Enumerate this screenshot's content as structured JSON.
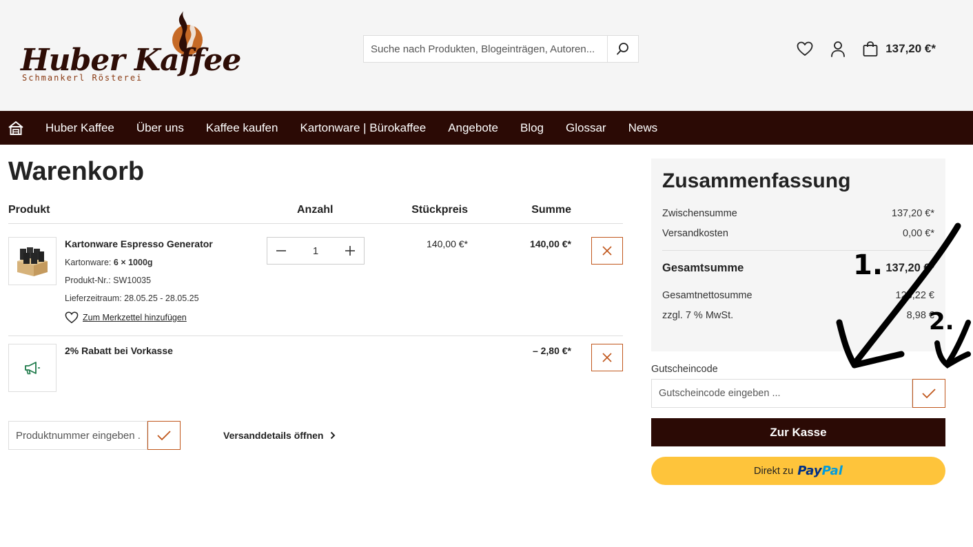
{
  "header": {
    "logo_title": "Huber Kaffee",
    "logo_subtitle": "Schmankerl Rösterei",
    "search_placeholder": "Suche nach Produkten, Blogeinträgen, Autoren...",
    "cart_total": "137,20 €*"
  },
  "nav": {
    "items": [
      "Huber Kaffee",
      "Über uns",
      "Kaffee kaufen",
      "Kartonware | Bürokaffee",
      "Angebote",
      "Blog",
      "Glossar",
      "News"
    ]
  },
  "cart": {
    "title": "Warenkorb",
    "columns": {
      "product": "Produkt",
      "quantity": "Anzahl",
      "unit_price": "Stückpreis",
      "total": "Summe"
    },
    "items": [
      {
        "name": "Kartonware Espresso Generator",
        "variant_label": "Kartonware:",
        "variant_value": "6 × 1000g",
        "sku": "Produkt-Nr.: SW10035",
        "delivery": "Lieferzeitraum: 28.05.25 - 28.05.25",
        "wishlist_link": "Zum Merkzettel hinzufügen",
        "quantity": "1",
        "unit_price": "140,00 €*",
        "total": "140,00 €*"
      },
      {
        "name": "2% Rabatt bei Vorkasse",
        "total": "– 2,80 €*"
      }
    ],
    "sku_placeholder": "Produktnummer eingeben ...",
    "shipping_link": "Versanddetails öffnen"
  },
  "summary": {
    "title": "Zusammenfassung",
    "subtotal_label": "Zwischensumme",
    "subtotal": "137,20 €*",
    "shipping_label": "Versandkosten",
    "shipping": "0,00 €*",
    "grand_total_label": "Gesamtsumme",
    "grand_total": "137,20 €*",
    "net_label": "Gesamtnettosumme",
    "net": "128,22 €",
    "tax_label": "zzgl. 7 % MwSt.",
    "tax": "8,98 €",
    "coupon_label": "Gutscheincode",
    "coupon_placeholder": "Gutscheincode eingeben ...",
    "checkout_button": "Zur Kasse",
    "paypal_prefix": "Direkt zu",
    "paypal_logo_pay": "Pay",
    "paypal_logo_pal": "Pal"
  },
  "annotations": {
    "marker_1": "1.",
    "marker_2": "2."
  },
  "colors": {
    "brand_dark": "#2b0a05",
    "accent": "#c0561b",
    "paypal_yellow": "#fec43b",
    "promo_green": "#1e7a4a"
  }
}
